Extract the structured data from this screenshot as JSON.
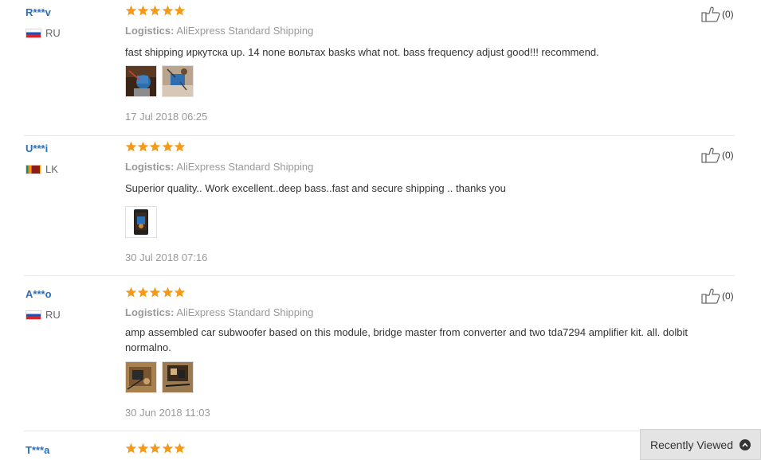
{
  "reviews": [
    {
      "user": "R***v",
      "country": "RU",
      "logistics_label": "Logistics:",
      "logistics_value": "AliExpress Standard Shipping",
      "comment": "fast shipping иркутска up. 14 none вольтах basks what not. bass frequency adjust good!!! recommend.",
      "date": "17 Jul 2018 06:25",
      "useful": "(0)",
      "stars": 5,
      "photos": 2
    },
    {
      "user": "U***i",
      "country": "LK",
      "logistics_label": "Logistics:",
      "logistics_value": "AliExpress Standard Shipping",
      "comment": "Superior quality.. Work excellent..deep bass..fast and secure shipping .. thanks you",
      "date": "30 Jul 2018 07:16",
      "useful": "(0)",
      "stars": 5,
      "photos": 1
    },
    {
      "user": "A***o",
      "country": "RU",
      "logistics_label": "Logistics:",
      "logistics_value": "AliExpress Standard Shipping",
      "comment": "amp assembled car subwoofer based on this module, bridge master from converter and two tda7294 amplifier kit. all. dolbit normalno.",
      "date": "30 Jun 2018 11:03",
      "useful": "(0)",
      "stars": 5,
      "photos": 2
    },
    {
      "user": "T***a",
      "stars": 5
    }
  ],
  "recently_viewed": "Recently Viewed",
  "colors": {
    "star": "#f49a18",
    "username": "#2a6ebb"
  },
  "icons": {
    "like": "thumbs-up-icon",
    "expand": "chevron-up-icon"
  }
}
